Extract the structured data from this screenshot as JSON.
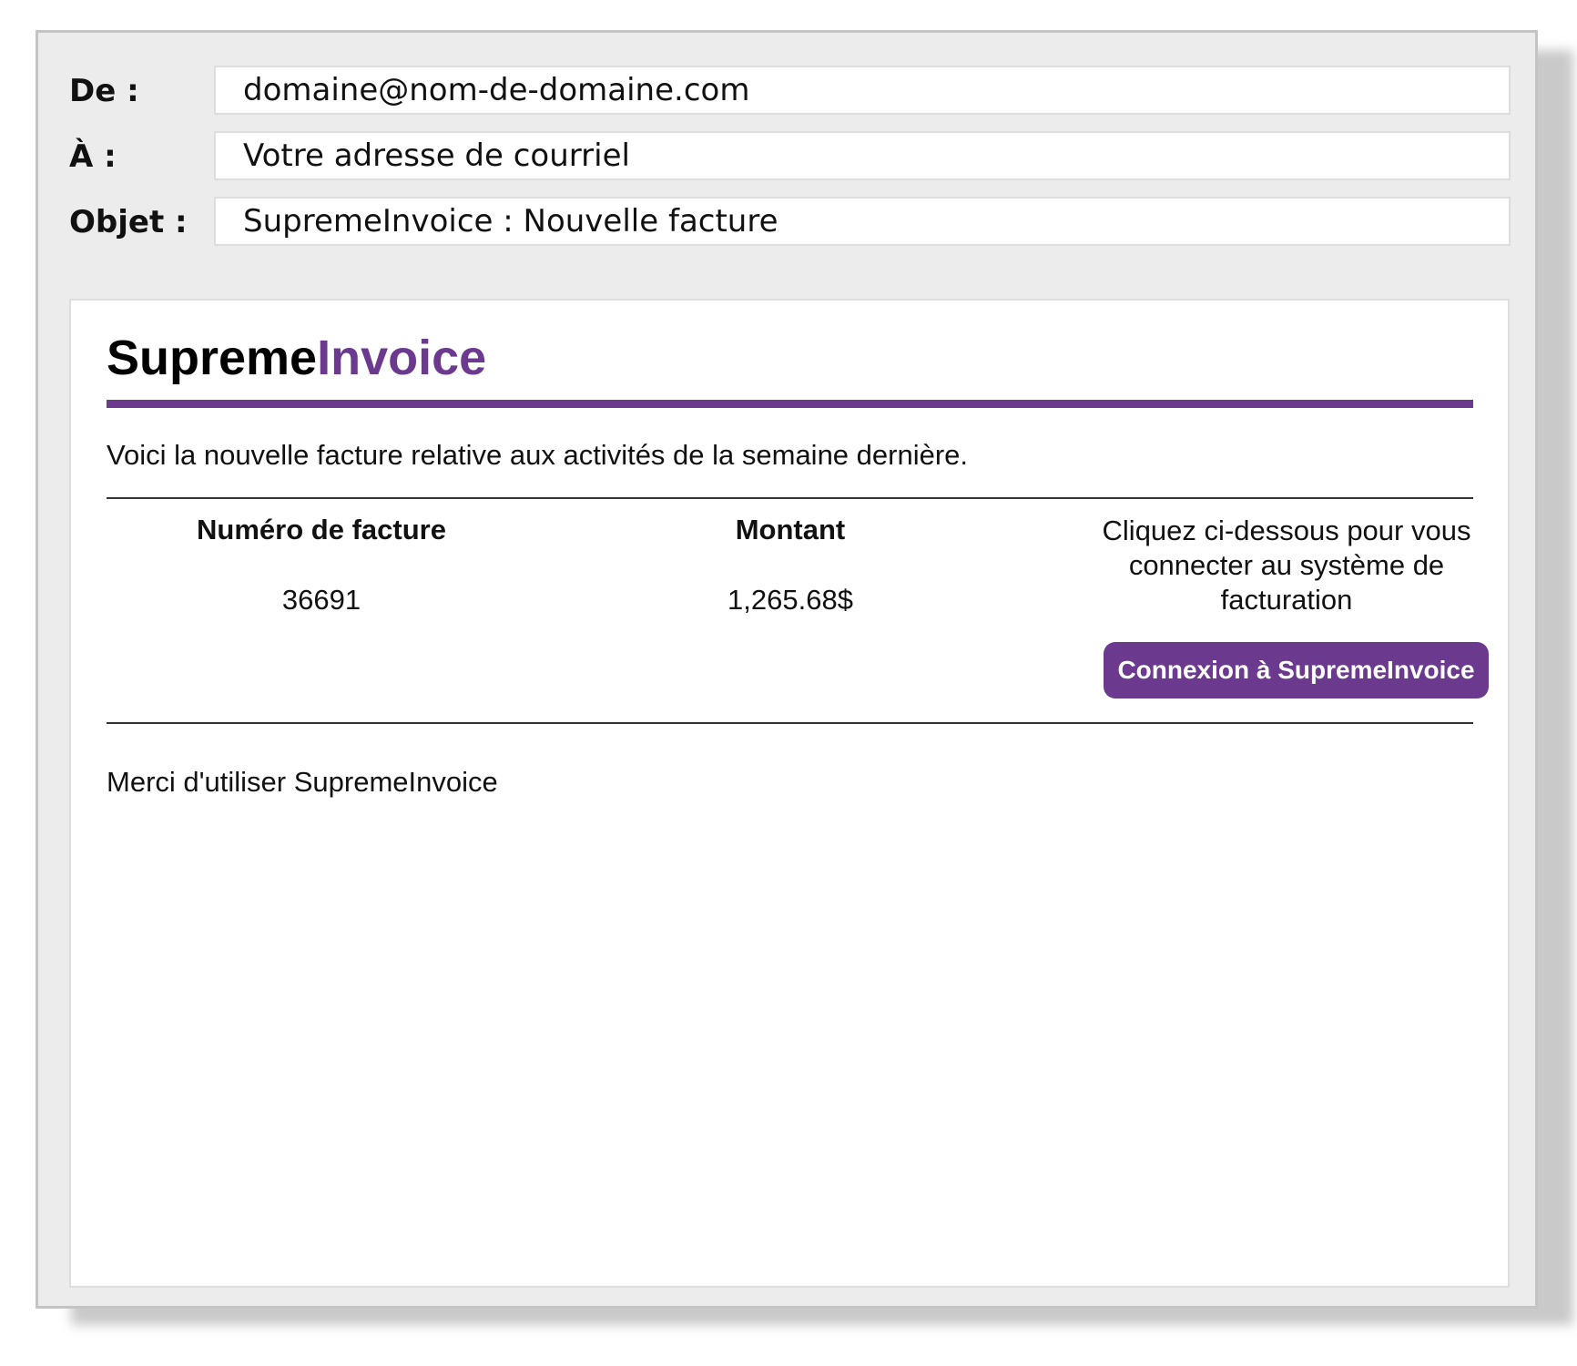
{
  "header": {
    "from_label": "De :",
    "from_value": "domaine@nom-de-domaine.com",
    "to_label": "À :",
    "to_value": "Votre adresse de courriel",
    "subject_label": "Objet :",
    "subject_value": "SupremeInvoice : Nouvelle facture"
  },
  "email": {
    "brand_part1": "Supreme",
    "brand_part2": "Invoice",
    "intro": "Voici la nouvelle facture relative aux activités de la semaine dernière.",
    "invoice_number_header": "Numéro de facture",
    "invoice_number": "36691",
    "amount_header": "Montant",
    "amount": "1,265.68$",
    "cta_text": "Cliquez ci-dessous pour vous connecter au système de facturation",
    "cta_button": "Connexion à SupremeInvoice",
    "thanks": "Merci d'utiliser SupremeInvoice"
  },
  "colors": {
    "accent": "#6b3a8f",
    "frame_background": "#ececec",
    "frame_border": "#c4c4c4"
  }
}
